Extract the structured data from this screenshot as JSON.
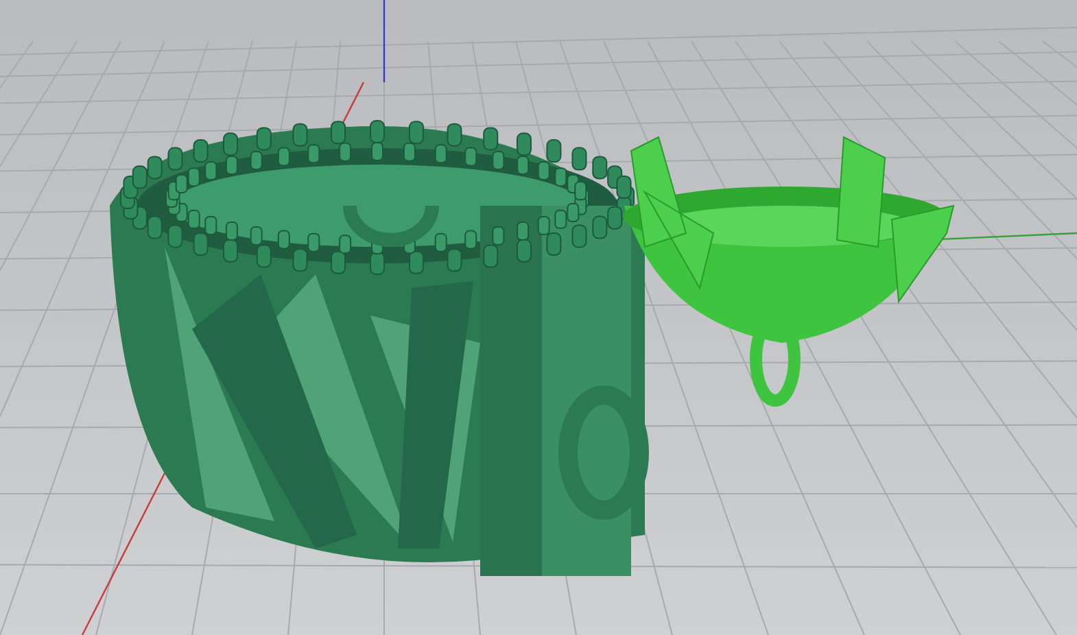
{
  "viewport": {
    "grid": true,
    "axes": true,
    "objects": [
      {
        "kind": "ring"
      },
      {
        "kind": "setting"
      }
    ]
  }
}
